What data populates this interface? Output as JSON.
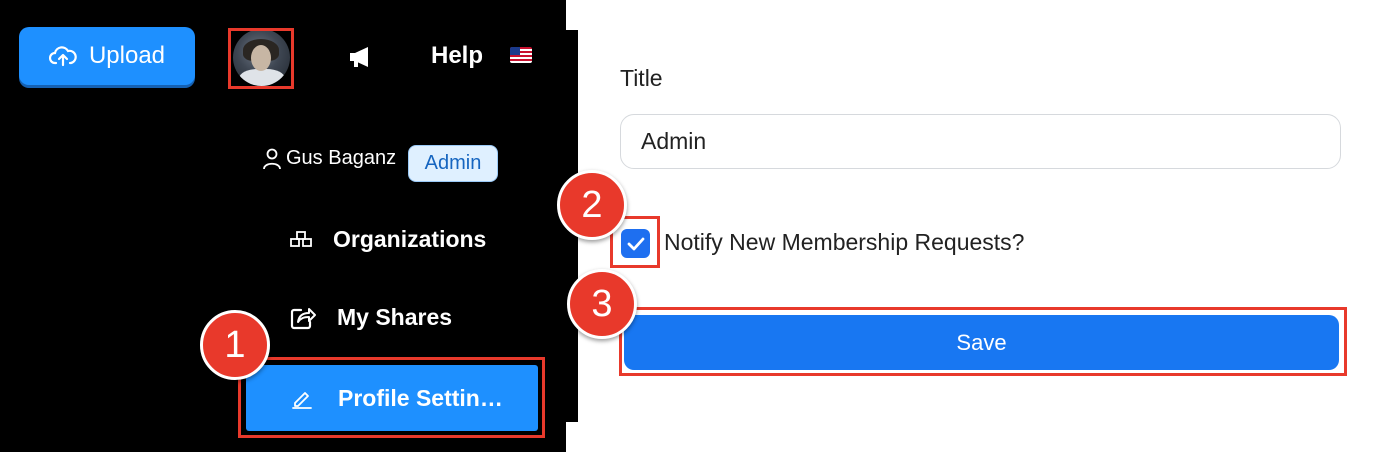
{
  "header": {
    "upload_label": "Upload",
    "help_label": "Help"
  },
  "user_menu": {
    "user_name": "Gus Baganz",
    "role_badge": "Admin",
    "items": [
      {
        "label": "Organizations",
        "icon": "organizations-icon"
      },
      {
        "label": "My Shares",
        "icon": "share-icon"
      },
      {
        "label": "Profile Settin…",
        "icon": "pencil-icon",
        "active": true
      }
    ]
  },
  "form": {
    "title_label": "Title",
    "title_value": "Admin",
    "notify_label": "Notify New Membership Requests?",
    "notify_checked": true,
    "save_label": "Save"
  },
  "annotations": {
    "step_1": "1",
    "step_2": "2",
    "step_3": "3"
  },
  "colors": {
    "accent": "#1e90ff",
    "highlight": "#e8392b",
    "menu_background": "#000000"
  }
}
